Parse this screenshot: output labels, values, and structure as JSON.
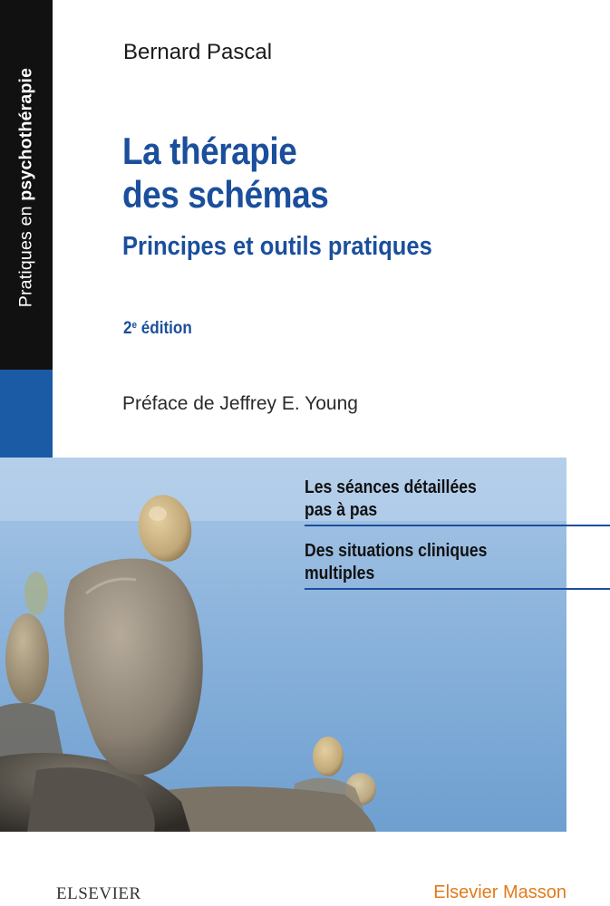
{
  "series": {
    "prefix": "Pratiques en ",
    "name": "psychothérapie"
  },
  "author": "Bernard Pascal",
  "title": {
    "line1": "La thérapie",
    "line2": "des schémas"
  },
  "subtitle": "Principes et outils pratiques",
  "edition": {
    "number": "2",
    "suffix": "e",
    "label": " édition"
  },
  "preface": "Préface de Jeffrey E. Young",
  "highlights": [
    {
      "line1": "Les séances détaillées",
      "line2": "pas à pas"
    },
    {
      "line1": "Des situations cliniques",
      "line2": "multiples"
    }
  ],
  "publishers": {
    "left": "ELSEVIER",
    "right": "Elsevier Masson"
  },
  "colors": {
    "brand_blue": "#1b4f9c",
    "spine_black": "#111111",
    "spine_blue": "#1b5aa5",
    "publisher_orange": "#e07b1c"
  }
}
